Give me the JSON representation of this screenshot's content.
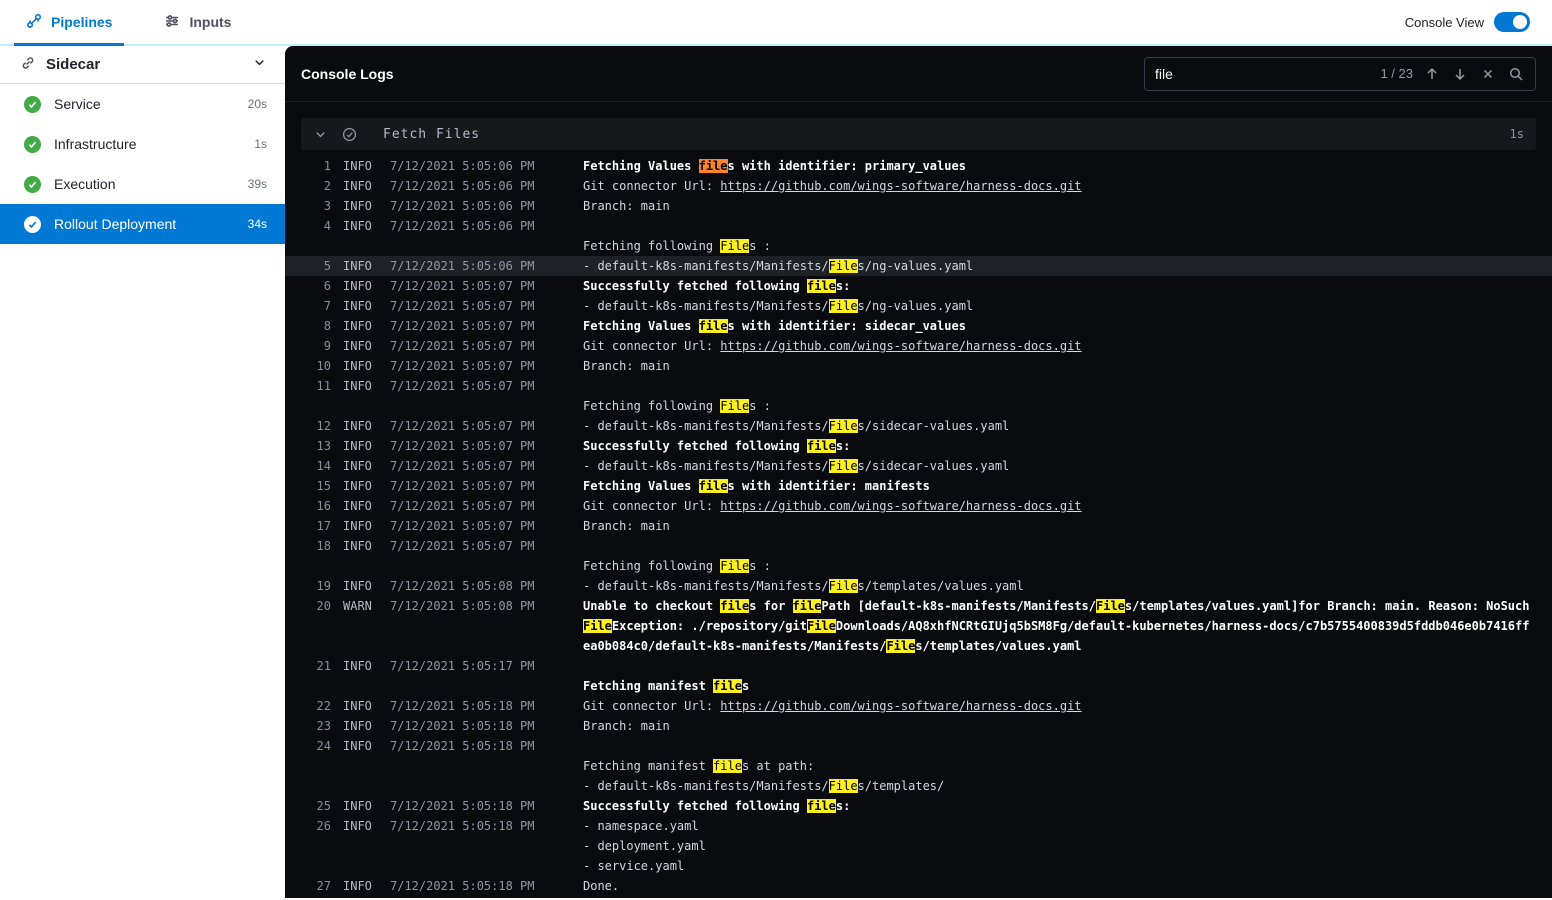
{
  "colors": {
    "accent": "#0278d5",
    "success": "#42ab45",
    "match_highlight": "#fdf021",
    "current_match_highlight": "#ff832b"
  },
  "topbar": {
    "tabs": [
      {
        "label": "Pipelines",
        "active": true
      },
      {
        "label": "Inputs",
        "active": false
      }
    ],
    "console_view_label": "Console View",
    "console_view_on": true
  },
  "sidebar": {
    "title": "Sidecar",
    "items": [
      {
        "label": "Service",
        "duration": "20s",
        "status": "success",
        "selected": false
      },
      {
        "label": "Infrastructure",
        "duration": "1s",
        "status": "success",
        "selected": false
      },
      {
        "label": "Execution",
        "duration": "39s",
        "status": "success",
        "selected": false
      },
      {
        "label": "Rollout Deployment",
        "duration": "34s",
        "status": "success",
        "selected": true
      }
    ]
  },
  "console": {
    "title": "Console Logs",
    "search": {
      "value": "file",
      "counter": "1 / 23"
    },
    "section": {
      "title": "Fetch Files",
      "duration": "1s"
    },
    "entries": [
      {
        "n": 1,
        "lvl": "INFO",
        "t": "7/12/2021 5:05:06 PM",
        "b": true,
        "lines": [
          [
            [
              "Fetching Values "
            ],
            [
              "file",
              "c"
            ],
            [
              "s with identifier: primary_values"
            ]
          ]
        ]
      },
      {
        "n": 2,
        "lvl": "INFO",
        "t": "7/12/2021 5:05:06 PM",
        "lines": [
          [
            [
              "Git connector Url: "
            ],
            [
              "https://github.com/wings-software/harness-docs.git",
              "l"
            ]
          ]
        ]
      },
      {
        "n": 3,
        "lvl": "INFO",
        "t": "7/12/2021 5:05:06 PM",
        "lines": [
          [
            [
              "Branch: main"
            ]
          ]
        ]
      },
      {
        "n": 4,
        "lvl": "INFO",
        "t": "7/12/2021 5:05:06 PM",
        "lines": [
          [],
          [
            [
              "Fetching following "
            ],
            [
              "File",
              "m"
            ],
            [
              "s :"
            ]
          ]
        ]
      },
      {
        "n": 5,
        "lvl": "INFO",
        "t": "7/12/2021 5:05:06 PM",
        "sel": true,
        "lines": [
          [
            [
              "- default-k8s-manifests/Manifests/"
            ],
            [
              "File",
              "m"
            ],
            [
              "s/ng-values.yaml"
            ]
          ]
        ]
      },
      {
        "n": 6,
        "lvl": "INFO",
        "t": "7/12/2021 5:05:07 PM",
        "b": true,
        "lines": [
          [
            [
              "Successfully fetched following "
            ],
            [
              "file",
              "m"
            ],
            [
              "s:"
            ]
          ]
        ]
      },
      {
        "n": 7,
        "lvl": "INFO",
        "t": "7/12/2021 5:05:07 PM",
        "lines": [
          [
            [
              "- default-k8s-manifests/Manifests/"
            ],
            [
              "File",
              "m"
            ],
            [
              "s/ng-values.yaml"
            ]
          ]
        ]
      },
      {
        "n": 8,
        "lvl": "INFO",
        "t": "7/12/2021 5:05:07 PM",
        "b": true,
        "lines": [
          [
            [
              "Fetching Values "
            ],
            [
              "file",
              "m"
            ],
            [
              "s with identifier: sidecar_values"
            ]
          ]
        ]
      },
      {
        "n": 9,
        "lvl": "INFO",
        "t": "7/12/2021 5:05:07 PM",
        "lines": [
          [
            [
              "Git connector Url: "
            ],
            [
              "https://github.com/wings-software/harness-docs.git",
              "l"
            ]
          ]
        ]
      },
      {
        "n": 10,
        "lvl": "INFO",
        "t": "7/12/2021 5:05:07 PM",
        "lines": [
          [
            [
              "Branch: main"
            ]
          ]
        ]
      },
      {
        "n": 11,
        "lvl": "INFO",
        "t": "7/12/2021 5:05:07 PM",
        "lines": [
          [],
          [
            [
              "Fetching following "
            ],
            [
              "File",
              "m"
            ],
            [
              "s :"
            ]
          ]
        ]
      },
      {
        "n": 12,
        "lvl": "INFO",
        "t": "7/12/2021 5:05:07 PM",
        "lines": [
          [
            [
              "- default-k8s-manifests/Manifests/"
            ],
            [
              "File",
              "m"
            ],
            [
              "s/sidecar-values.yaml"
            ]
          ]
        ]
      },
      {
        "n": 13,
        "lvl": "INFO",
        "t": "7/12/2021 5:05:07 PM",
        "b": true,
        "lines": [
          [
            [
              "Successfully fetched following "
            ],
            [
              "file",
              "m"
            ],
            [
              "s:"
            ]
          ]
        ]
      },
      {
        "n": 14,
        "lvl": "INFO",
        "t": "7/12/2021 5:05:07 PM",
        "lines": [
          [
            [
              "- default-k8s-manifests/Manifests/"
            ],
            [
              "File",
              "m"
            ],
            [
              "s/sidecar-values.yaml"
            ]
          ]
        ]
      },
      {
        "n": 15,
        "lvl": "INFO",
        "t": "7/12/2021 5:05:07 PM",
        "b": true,
        "lines": [
          [
            [
              "Fetching Values "
            ],
            [
              "file",
              "m"
            ],
            [
              "s with identifier: manifests"
            ]
          ]
        ]
      },
      {
        "n": 16,
        "lvl": "INFO",
        "t": "7/12/2021 5:05:07 PM",
        "lines": [
          [
            [
              "Git connector Url: "
            ],
            [
              "https://github.com/wings-software/harness-docs.git",
              "l"
            ]
          ]
        ]
      },
      {
        "n": 17,
        "lvl": "INFO",
        "t": "7/12/2021 5:05:07 PM",
        "lines": [
          [
            [
              "Branch: main"
            ]
          ]
        ]
      },
      {
        "n": 18,
        "lvl": "INFO",
        "t": "7/12/2021 5:05:07 PM",
        "lines": [
          [],
          [
            [
              "Fetching following "
            ],
            [
              "File",
              "m"
            ],
            [
              "s :"
            ]
          ]
        ]
      },
      {
        "n": 19,
        "lvl": "INFO",
        "t": "7/12/2021 5:05:08 PM",
        "lines": [
          [
            [
              "- default-k8s-manifests/Manifests/"
            ],
            [
              "File",
              "m"
            ],
            [
              "s/templates/values.yaml"
            ]
          ]
        ]
      },
      {
        "n": 20,
        "lvl": "WARN",
        "t": "7/12/2021 5:05:08 PM",
        "b": true,
        "lines": [
          [
            [
              "Unable to checkout "
            ],
            [
              "file",
              "m"
            ],
            [
              "s for "
            ],
            [
              "file",
              "m"
            ],
            [
              "Path [default-k8s-manifests/Manifests/"
            ],
            [
              "File",
              "m"
            ],
            [
              "s/templates/values.yaml]for Branch: main. Reason: NoSuch"
            ],
            [
              "File",
              "m"
            ],
            [
              "Exception: ./repository/git"
            ],
            [
              "File",
              "m"
            ],
            [
              "Downloads/AQ8xhfNCRtGIUjq5bSM8Fg/default-kubernetes/harness-docs/c7b5755400839d5fddb046e0b7416ffea0b084c0/default-k8s-manifests/Manifests/"
            ],
            [
              "File",
              "m"
            ],
            [
              "s/templates/values.yaml"
            ]
          ]
        ]
      },
      {
        "n": 21,
        "lvl": "INFO",
        "t": "7/12/2021 5:05:17 PM",
        "b": true,
        "lines": [
          [],
          [
            [
              "Fetching manifest "
            ],
            [
              "file",
              "m"
            ],
            [
              "s"
            ]
          ]
        ]
      },
      {
        "n": 22,
        "lvl": "INFO",
        "t": "7/12/2021 5:05:18 PM",
        "lines": [
          [
            [
              "Git connector Url: "
            ],
            [
              "https://github.com/wings-software/harness-docs.git",
              "l"
            ]
          ]
        ]
      },
      {
        "n": 23,
        "lvl": "INFO",
        "t": "7/12/2021 5:05:18 PM",
        "lines": [
          [
            [
              "Branch: main"
            ]
          ]
        ]
      },
      {
        "n": 24,
        "lvl": "INFO",
        "t": "7/12/2021 5:05:18 PM",
        "lines": [
          [],
          [
            [
              "Fetching manifest "
            ],
            [
              "file",
              "m"
            ],
            [
              "s at path:"
            ]
          ],
          [
            [
              "- default-k8s-manifests/Manifests/"
            ],
            [
              "File",
              "m"
            ],
            [
              "s/templates/"
            ]
          ]
        ]
      },
      {
        "n": 25,
        "lvl": "INFO",
        "t": "7/12/2021 5:05:18 PM",
        "b": true,
        "lines": [
          [
            [
              "Successfully fetched following "
            ],
            [
              "file",
              "m"
            ],
            [
              "s:"
            ]
          ]
        ]
      },
      {
        "n": 26,
        "lvl": "INFO",
        "t": "7/12/2021 5:05:18 PM",
        "lines": [
          [
            [
              "- namespace.yaml"
            ]
          ],
          [
            [
              "- deployment.yaml"
            ]
          ],
          [
            [
              "- service.yaml"
            ]
          ]
        ]
      },
      {
        "n": 27,
        "lvl": "INFO",
        "t": "7/12/2021 5:05:18 PM",
        "lines": [
          [
            [
              "Done."
            ]
          ]
        ]
      }
    ]
  }
}
